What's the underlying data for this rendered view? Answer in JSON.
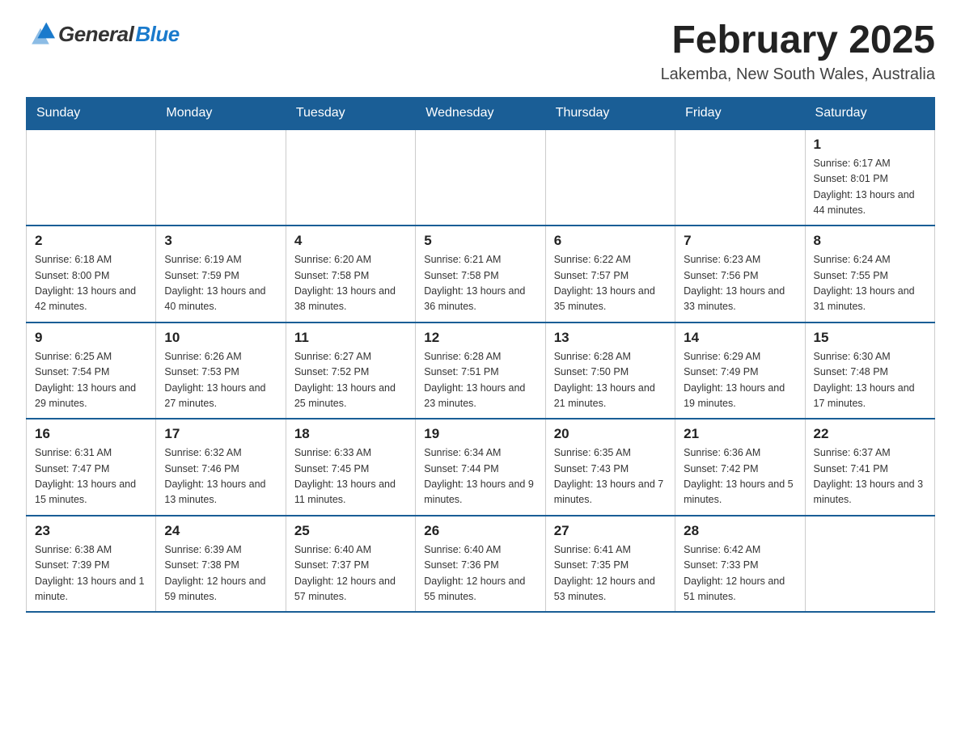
{
  "header": {
    "logo_general": "General",
    "logo_blue": "Blue",
    "title": "February 2025",
    "subtitle": "Lakemba, New South Wales, Australia"
  },
  "days_of_week": [
    "Sunday",
    "Monday",
    "Tuesday",
    "Wednesday",
    "Thursday",
    "Friday",
    "Saturday"
  ],
  "weeks": [
    [
      {
        "day": "",
        "info": "",
        "empty": true
      },
      {
        "day": "",
        "info": "",
        "empty": true
      },
      {
        "day": "",
        "info": "",
        "empty": true
      },
      {
        "day": "",
        "info": "",
        "empty": true
      },
      {
        "day": "",
        "info": "",
        "empty": true
      },
      {
        "day": "",
        "info": "",
        "empty": true
      },
      {
        "day": "1",
        "info": "Sunrise: 6:17 AM\nSunset: 8:01 PM\nDaylight: 13 hours and 44 minutes.",
        "empty": false
      }
    ],
    [
      {
        "day": "2",
        "info": "Sunrise: 6:18 AM\nSunset: 8:00 PM\nDaylight: 13 hours and 42 minutes.",
        "empty": false
      },
      {
        "day": "3",
        "info": "Sunrise: 6:19 AM\nSunset: 7:59 PM\nDaylight: 13 hours and 40 minutes.",
        "empty": false
      },
      {
        "day": "4",
        "info": "Sunrise: 6:20 AM\nSunset: 7:58 PM\nDaylight: 13 hours and 38 minutes.",
        "empty": false
      },
      {
        "day": "5",
        "info": "Sunrise: 6:21 AM\nSunset: 7:58 PM\nDaylight: 13 hours and 36 minutes.",
        "empty": false
      },
      {
        "day": "6",
        "info": "Sunrise: 6:22 AM\nSunset: 7:57 PM\nDaylight: 13 hours and 35 minutes.",
        "empty": false
      },
      {
        "day": "7",
        "info": "Sunrise: 6:23 AM\nSunset: 7:56 PM\nDaylight: 13 hours and 33 minutes.",
        "empty": false
      },
      {
        "day": "8",
        "info": "Sunrise: 6:24 AM\nSunset: 7:55 PM\nDaylight: 13 hours and 31 minutes.",
        "empty": false
      }
    ],
    [
      {
        "day": "9",
        "info": "Sunrise: 6:25 AM\nSunset: 7:54 PM\nDaylight: 13 hours and 29 minutes.",
        "empty": false
      },
      {
        "day": "10",
        "info": "Sunrise: 6:26 AM\nSunset: 7:53 PM\nDaylight: 13 hours and 27 minutes.",
        "empty": false
      },
      {
        "day": "11",
        "info": "Sunrise: 6:27 AM\nSunset: 7:52 PM\nDaylight: 13 hours and 25 minutes.",
        "empty": false
      },
      {
        "day": "12",
        "info": "Sunrise: 6:28 AM\nSunset: 7:51 PM\nDaylight: 13 hours and 23 minutes.",
        "empty": false
      },
      {
        "day": "13",
        "info": "Sunrise: 6:28 AM\nSunset: 7:50 PM\nDaylight: 13 hours and 21 minutes.",
        "empty": false
      },
      {
        "day": "14",
        "info": "Sunrise: 6:29 AM\nSunset: 7:49 PM\nDaylight: 13 hours and 19 minutes.",
        "empty": false
      },
      {
        "day": "15",
        "info": "Sunrise: 6:30 AM\nSunset: 7:48 PM\nDaylight: 13 hours and 17 minutes.",
        "empty": false
      }
    ],
    [
      {
        "day": "16",
        "info": "Sunrise: 6:31 AM\nSunset: 7:47 PM\nDaylight: 13 hours and 15 minutes.",
        "empty": false
      },
      {
        "day": "17",
        "info": "Sunrise: 6:32 AM\nSunset: 7:46 PM\nDaylight: 13 hours and 13 minutes.",
        "empty": false
      },
      {
        "day": "18",
        "info": "Sunrise: 6:33 AM\nSunset: 7:45 PM\nDaylight: 13 hours and 11 minutes.",
        "empty": false
      },
      {
        "day": "19",
        "info": "Sunrise: 6:34 AM\nSunset: 7:44 PM\nDaylight: 13 hours and 9 minutes.",
        "empty": false
      },
      {
        "day": "20",
        "info": "Sunrise: 6:35 AM\nSunset: 7:43 PM\nDaylight: 13 hours and 7 minutes.",
        "empty": false
      },
      {
        "day": "21",
        "info": "Sunrise: 6:36 AM\nSunset: 7:42 PM\nDaylight: 13 hours and 5 minutes.",
        "empty": false
      },
      {
        "day": "22",
        "info": "Sunrise: 6:37 AM\nSunset: 7:41 PM\nDaylight: 13 hours and 3 minutes.",
        "empty": false
      }
    ],
    [
      {
        "day": "23",
        "info": "Sunrise: 6:38 AM\nSunset: 7:39 PM\nDaylight: 13 hours and 1 minute.",
        "empty": false
      },
      {
        "day": "24",
        "info": "Sunrise: 6:39 AM\nSunset: 7:38 PM\nDaylight: 12 hours and 59 minutes.",
        "empty": false
      },
      {
        "day": "25",
        "info": "Sunrise: 6:40 AM\nSunset: 7:37 PM\nDaylight: 12 hours and 57 minutes.",
        "empty": false
      },
      {
        "day": "26",
        "info": "Sunrise: 6:40 AM\nSunset: 7:36 PM\nDaylight: 12 hours and 55 minutes.",
        "empty": false
      },
      {
        "day": "27",
        "info": "Sunrise: 6:41 AM\nSunset: 7:35 PM\nDaylight: 12 hours and 53 minutes.",
        "empty": false
      },
      {
        "day": "28",
        "info": "Sunrise: 6:42 AM\nSunset: 7:33 PM\nDaylight: 12 hours and 51 minutes.",
        "empty": false
      },
      {
        "day": "",
        "info": "",
        "empty": true
      }
    ]
  ]
}
